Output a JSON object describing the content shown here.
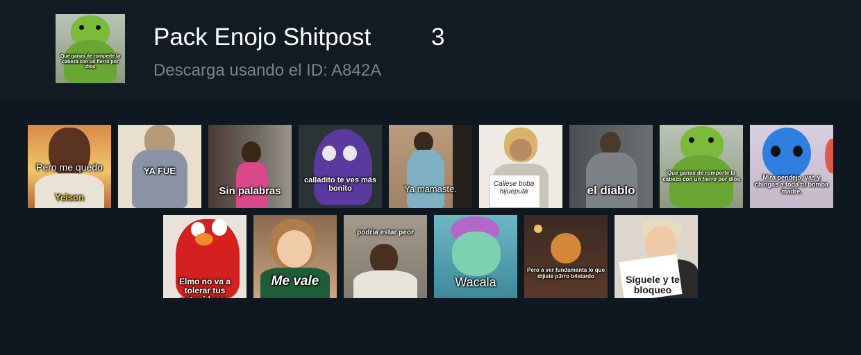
{
  "pack": {
    "title": "Pack Enojo Shitpost",
    "count": "3",
    "download_text": "Descarga usando el ID: A842A",
    "cover_caption": "Que ganas de romperte la cabeza con un fierro por dios"
  },
  "stickers": [
    {
      "caption": "Pero me quedo",
      "caption2": "Yeison"
    },
    {
      "caption": "YA FUE"
    },
    {
      "caption": "Sin palabras"
    },
    {
      "caption": "calladito te ves más bonito"
    },
    {
      "caption": "Ya mamaste."
    },
    {
      "caption": "Callese boba hijueputa"
    },
    {
      "caption": "el diablo"
    },
    {
      "caption": "Que ganas de romperte la cabeza con un fierro por dios"
    },
    {
      "caption": "Mira pendejo, vas y chingas a toda tu bomba madre."
    },
    {
      "caption": "Elmo no va a tolerar tus estupideces"
    },
    {
      "caption": "Me vale"
    },
    {
      "caption": "podria estar peor"
    },
    {
      "caption": "Wacala"
    },
    {
      "caption": "Pero a ver fundamenta lo que dijiste p3rro b4stardo"
    },
    {
      "caption": "Síguele y te bloqueo"
    }
  ]
}
